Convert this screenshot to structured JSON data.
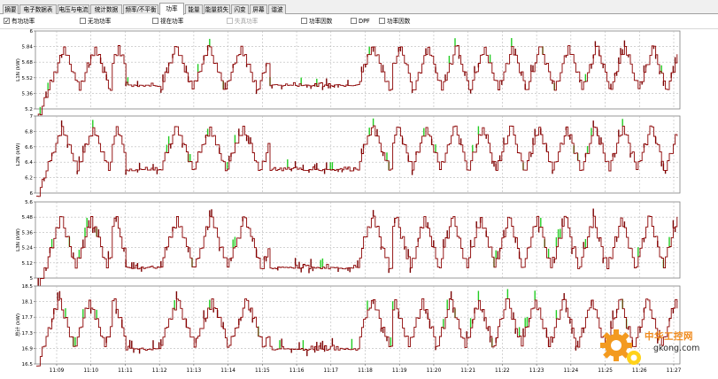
{
  "tabs": [
    {
      "label": "摘要",
      "active": false
    },
    {
      "label": "电子数据表",
      "active": false
    },
    {
      "label": "电压与电流",
      "active": false
    },
    {
      "label": "统计数据",
      "active": false
    },
    {
      "label": "频率/不平衡",
      "active": false
    },
    {
      "label": "功率",
      "active": true
    },
    {
      "label": "能量",
      "active": false
    },
    {
      "label": "能量损失",
      "active": false
    },
    {
      "label": "闪变",
      "active": false
    },
    {
      "label": "屏幕",
      "active": false
    },
    {
      "label": "谐波",
      "active": false
    }
  ],
  "options": [
    {
      "label": "有功功率",
      "checked": true,
      "enabled": true
    },
    {
      "label": "无功功率",
      "checked": false,
      "enabled": true
    },
    {
      "label": "视在功率",
      "checked": false,
      "enabled": true
    },
    {
      "label": "失真功率",
      "checked": false,
      "enabled": false
    },
    {
      "label": "功率因数",
      "checked": false,
      "enabled": true
    },
    {
      "label": "DPF",
      "checked": false,
      "enabled": true
    },
    {
      "label": "功率因数",
      "checked": false,
      "enabled": true
    }
  ],
  "watermark": {
    "name": "中华工控网",
    "url": "gkong.com"
  },
  "chart_data": {
    "type": "line",
    "x_ticks": [
      "11:09",
      "11:10",
      "11:11",
      "11:12",
      "11:13",
      "11:14",
      "11:15",
      "11:16",
      "11:17",
      "11:18",
      "11:19",
      "11:20",
      "11:21",
      "11:22",
      "11:23",
      "11:24",
      "11:25",
      "11:26",
      "11:27"
    ],
    "colors": {
      "avg": "#8b0000",
      "max": "#22cc22",
      "min": "#7a0000"
    },
    "panels": [
      {
        "ylabel": "L1N (kW)",
        "yticks": [
          "6",
          "5.84",
          "5.68",
          "5.52",
          "5.36",
          "5.2"
        ],
        "ylim": [
          5.2,
          6.0
        ],
        "high": 5.84,
        "low": 5.4,
        "step": 0.04,
        "quiet": 5.44,
        "quiet_range": [
          2,
          4
        ]
      },
      {
        "ylabel": "L2N (kW)",
        "yticks": [
          "7",
          "6.8",
          "6.6",
          "6.4",
          "6.2",
          "6"
        ],
        "ylim": [
          6.0,
          7.0
        ],
        "high": 6.86,
        "low": 6.3,
        "step": 0.05,
        "quiet": 6.3,
        "quiet_range": [
          2,
          4
        ]
      },
      {
        "ylabel": "L3N (kW)",
        "yticks": [
          "5.6",
          "5.48",
          "5.36",
          "5.24",
          "5.12",
          "5"
        ],
        "ylim": [
          5.0,
          5.6
        ],
        "high": 5.48,
        "low": 5.08,
        "step": 0.035,
        "quiet": 5.08,
        "quiet_range": [
          2,
          4
        ]
      },
      {
        "ylabel": "总计 (kW)",
        "yticks": [
          "18.5",
          "18.1",
          "17.7",
          "17.3",
          "16.9",
          "16.5"
        ],
        "ylim": [
          16.5,
          18.5
        ],
        "high": 18.15,
        "low": 16.95,
        "step": 0.12,
        "quiet": 16.88,
        "quiet_range": [
          2,
          4
        ]
      }
    ]
  }
}
